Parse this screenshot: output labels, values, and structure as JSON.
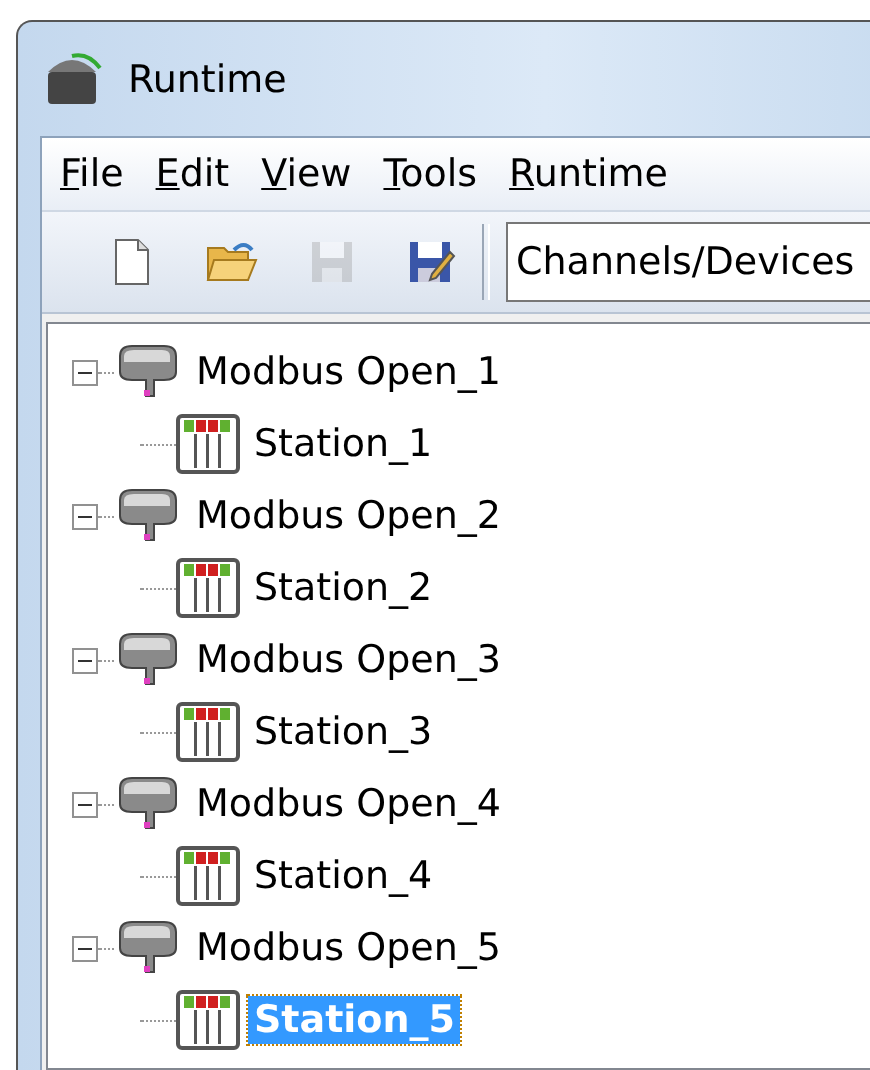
{
  "window": {
    "title": "Runtime"
  },
  "menu": [
    {
      "label": "File",
      "underline_first": true
    },
    {
      "label": "Edit",
      "underline_first": true
    },
    {
      "label": "View",
      "underline_first": true
    },
    {
      "label": "Tools",
      "underline_first": true
    },
    {
      "label": "Runtime",
      "underline_first": true
    }
  ],
  "toolbar": {
    "buttons": [
      {
        "kind": "new",
        "disabled": false
      },
      {
        "kind": "open",
        "disabled": false
      },
      {
        "kind": "save",
        "disabled": true
      },
      {
        "kind": "save_as",
        "disabled": false
      }
    ],
    "view_select": {
      "value": "Channels/Devices"
    }
  },
  "tree": [
    {
      "label": "Modbus Open_1",
      "kind": "channel",
      "expanded": true,
      "selected": false,
      "children": [
        {
          "label": "Station_1",
          "kind": "device",
          "selected": false
        }
      ]
    },
    {
      "label": "Modbus Open_2",
      "kind": "channel",
      "expanded": true,
      "selected": false,
      "children": [
        {
          "label": "Station_2",
          "kind": "device",
          "selected": false
        }
      ]
    },
    {
      "label": "Modbus Open_3",
      "kind": "channel",
      "expanded": true,
      "selected": false,
      "children": [
        {
          "label": "Station_3",
          "kind": "device",
          "selected": false
        }
      ]
    },
    {
      "label": "Modbus Open_4",
      "kind": "channel",
      "expanded": true,
      "selected": false,
      "children": [
        {
          "label": "Station_4",
          "kind": "device",
          "selected": false
        }
      ]
    },
    {
      "label": "Modbus Open_5",
      "kind": "channel",
      "expanded": true,
      "selected": false,
      "children": [
        {
          "label": "Station_5",
          "kind": "device",
          "selected": true
        }
      ]
    }
  ]
}
